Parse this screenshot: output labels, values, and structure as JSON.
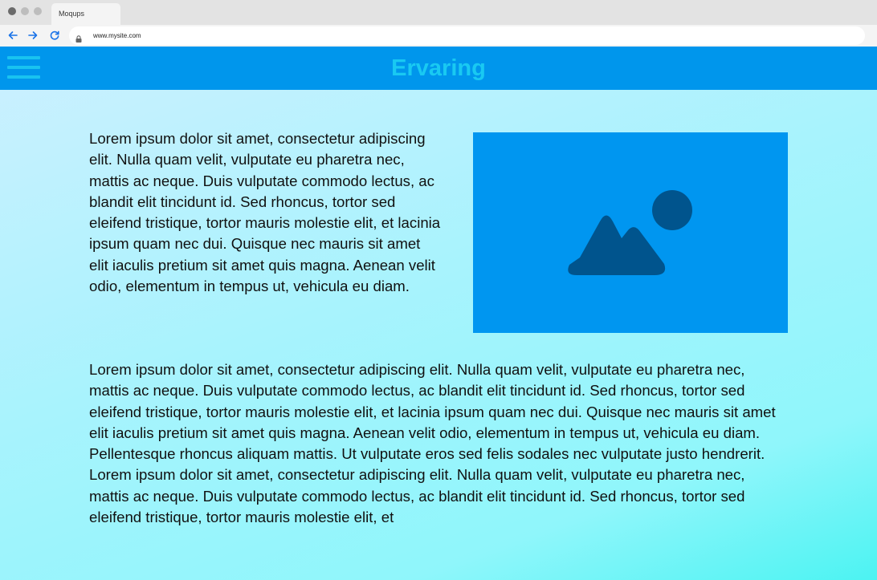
{
  "browser": {
    "tab_title": "Moqups",
    "url": "www.mysite.com"
  },
  "header": {
    "title": "Ervaring"
  },
  "content": {
    "intro_paragraph": "Lorem ipsum dolor sit amet, consectetur adipiscing elit. Nulla quam velit, vulputate eu pharetra nec, mattis ac neque. Duis vulputate commodo lectus, ac blandit elit tincidunt id. Sed rhoncus, tortor sed eleifend tristique, tortor mauris molestie elit, et lacinia ipsum quam nec dui. Quisque nec mauris sit amet elit iaculis pretium sit amet quis magna. Aenean velit odio, elementum in tempus ut, vehicula eu diam.",
    "body_paragraph": "Lorem ipsum dolor sit amet, consectetur adipiscing elit. Nulla quam velit, vulputate eu pharetra nec, mattis ac neque. Duis vulputate commodo lectus, ac blandit elit tincidunt id. Sed rhoncus, tortor sed eleifend tristique, tortor mauris molestie elit, et lacinia ipsum quam nec dui. Quisque nec mauris sit amet elit iaculis pretium sit amet quis magna. Aenean velit odio, elementum in tempus ut, vehicula eu diam. Pellentesque rhoncus aliquam mattis. Ut vulputate eros sed felis sodales nec vulputate justo hendrerit. Lorem ipsum dolor sit amet, consectetur adipiscing elit. Nulla quam velit, vulputate eu pharetra nec, mattis ac neque. Duis vulputate commodo lectus, ac blandit elit tincidunt id. Sed rhoncus, tortor sed eleifend tristique, tortor mauris molestie elit, et"
  },
  "icons": {
    "back": "arrow-left-icon",
    "forward": "arrow-right-icon",
    "reload": "reload-icon",
    "lock": "lock-icon",
    "menu": "hamburger-menu-icon",
    "image": "image-placeholder-icon"
  },
  "colors": {
    "header_bg": "#0096ec",
    "title": "#19c9f2",
    "image_bg": "#0096f0",
    "image_icon": "#00548d"
  }
}
